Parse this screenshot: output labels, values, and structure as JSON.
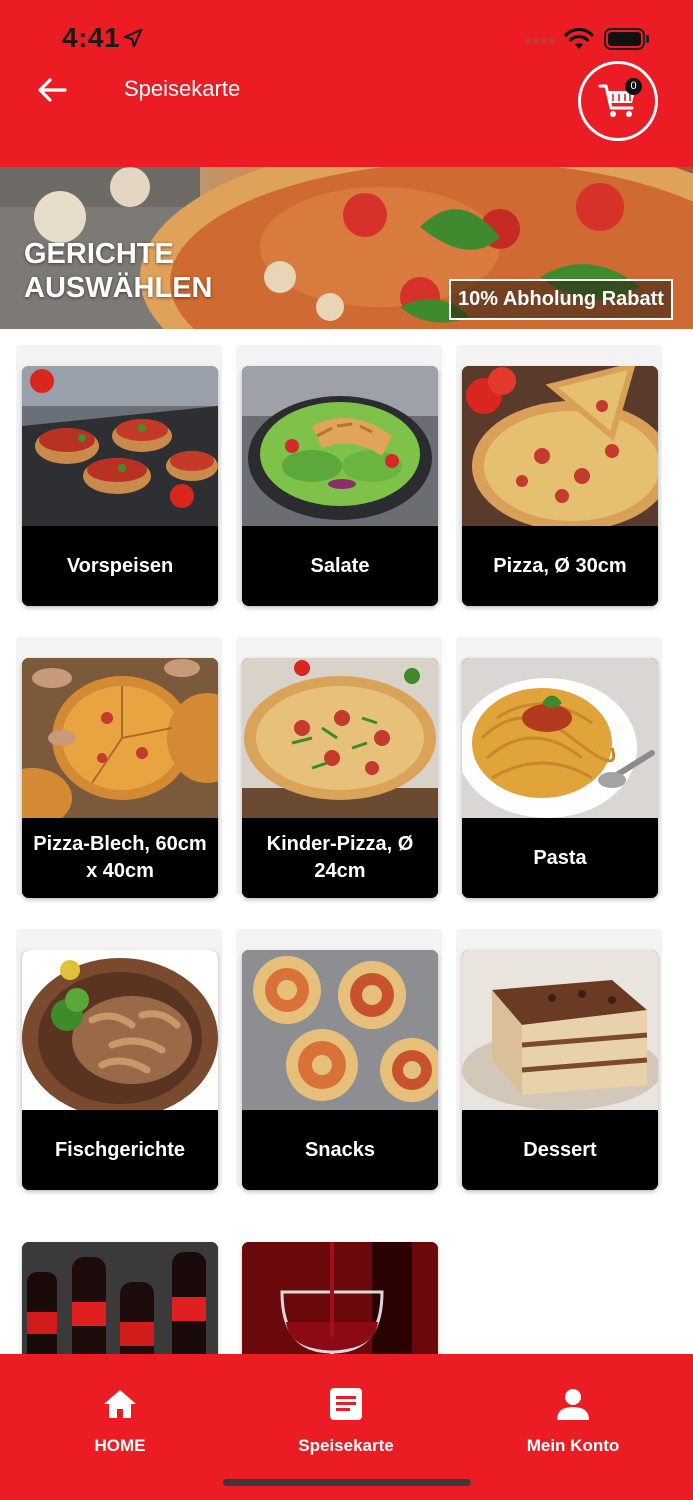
{
  "status_bar": {
    "time": "4:41",
    "icons": [
      "location-arrow-icon",
      "signal-dots-icon",
      "wifi-icon",
      "battery-icon"
    ]
  },
  "header": {
    "title": "Speisekarte",
    "back_icon": "arrow-left-icon",
    "cart_icon": "shopping-cart-icon",
    "cart_count": "0"
  },
  "banner": {
    "title": "GERICHTE AUSWÄHLEN",
    "badge": "10% Abholung Rabatt"
  },
  "categories": [
    {
      "label": "Vorspeisen",
      "image": "bruschetta"
    },
    {
      "label": "Salate",
      "image": "chicken-salad"
    },
    {
      "label": "Pizza, Ø 30cm",
      "image": "pizza"
    },
    {
      "label": "Pizza-Blech, 60cm x 40cm",
      "image": "sheet-pizza"
    },
    {
      "label": "Kinder-Pizza, Ø 24cm",
      "image": "kids-pizza"
    },
    {
      "label": "Pasta",
      "image": "spaghetti"
    },
    {
      "label": "Fischgerichte",
      "image": "seafood-plate"
    },
    {
      "label": "Snacks",
      "image": "pizza-rolls"
    },
    {
      "label": "Dessert",
      "image": "tiramisu"
    },
    {
      "label": "",
      "image": "cola-bottles"
    },
    {
      "label": "",
      "image": "red-wine"
    }
  ],
  "bottom_nav": {
    "items": [
      {
        "label": "HOME",
        "icon": "home-icon"
      },
      {
        "label": "Speisekarte",
        "icon": "menu-list-icon"
      },
      {
        "label": "Mein Konto",
        "icon": "user-icon"
      }
    ]
  },
  "colors": {
    "brand_red": "#ec1c24",
    "tile_black": "#000000",
    "white": "#ffffff"
  }
}
